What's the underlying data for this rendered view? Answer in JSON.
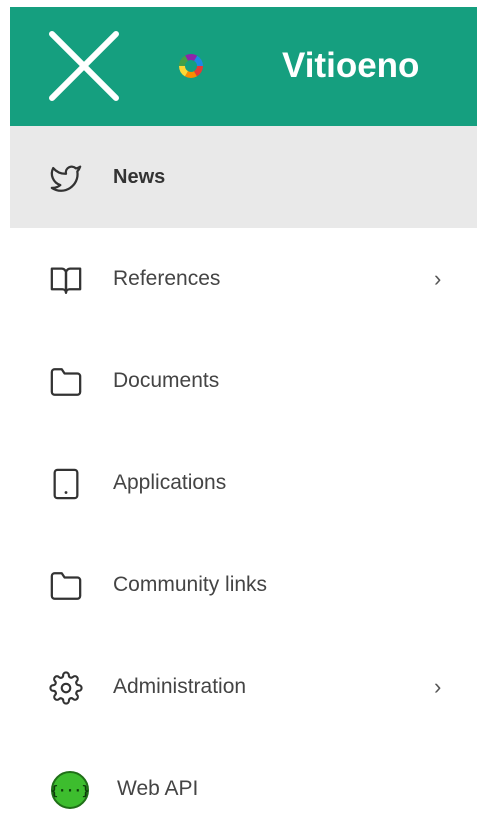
{
  "header": {
    "title": "Vitioeno",
    "close_icon": "close-icon",
    "logo_icon": "colorful-ring-logo",
    "background_color": "#159f7f"
  },
  "nav": {
    "active_background": "#e9e9e9",
    "items": [
      {
        "label": "News",
        "icon": "twitter-bird-icon",
        "active": true,
        "has_submenu": false
      },
      {
        "label": "References",
        "icon": "book-icon",
        "active": false,
        "has_submenu": true
      },
      {
        "label": "Documents",
        "icon": "folder-icon",
        "active": false,
        "has_submenu": false
      },
      {
        "label": "Applications",
        "icon": "tablet-icon",
        "active": false,
        "has_submenu": false
      },
      {
        "label": "Community links",
        "icon": "folder-icon",
        "active": false,
        "has_submenu": false
      },
      {
        "label": "Administration",
        "icon": "gear-icon",
        "active": false,
        "has_submenu": true
      },
      {
        "label": "Web API",
        "icon": "api-icon",
        "active": false,
        "has_submenu": false
      }
    ],
    "chevron_glyph": "›",
    "api_icon_color": "#3dbd2e"
  }
}
